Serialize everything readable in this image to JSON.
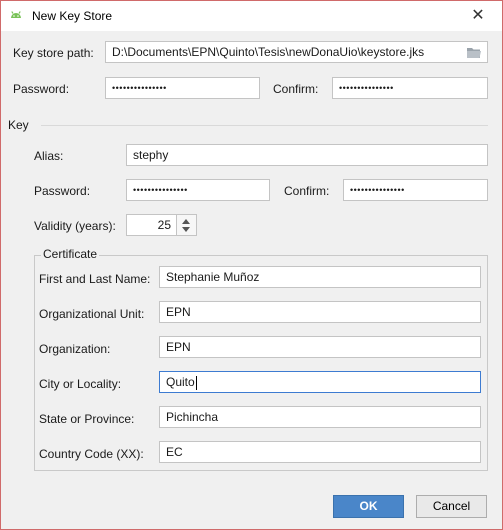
{
  "window": {
    "title": "New Key Store",
    "close_glyph": "✕",
    "icon": "android-icon"
  },
  "keystore": {
    "path_label": "Key store path:",
    "path_value": "D:\\Documents\\EPN\\Quinto\\Tesis\\newDonaUio\\keystore.jks",
    "browse_icon": "folder-icon",
    "password_label": "Password:",
    "password_value": "•••••••••••••••",
    "confirm_label": "Confirm:",
    "confirm_value": "•••••••••••••••"
  },
  "key": {
    "group_label": "Key",
    "alias_label": "Alias:",
    "alias_value": "stephy",
    "password_label": "Password:",
    "password_value": "•••••••••••••••",
    "confirm_label": "Confirm:",
    "confirm_value": "•••••••••••••••",
    "validity_label": "Validity (years):",
    "validity_value": "25"
  },
  "certificate": {
    "group_label": "Certificate",
    "fields": [
      {
        "label": "First and Last Name:",
        "value": "Stephanie Muñoz"
      },
      {
        "label": "Organizational Unit:",
        "value": "EPN"
      },
      {
        "label": "Organization:",
        "value": "EPN"
      },
      {
        "label": "City or Locality:",
        "value": "Quito"
      },
      {
        "label": "State or Province:",
        "value": "Pichincha"
      },
      {
        "label": "Country Code (XX):",
        "value": "EC"
      }
    ]
  },
  "buttons": {
    "ok_label": "OK",
    "cancel_label": "Cancel"
  },
  "colors": {
    "primary_button": "#4a86c9",
    "focus_border": "#3d7bd1",
    "android_green": "#78c257"
  }
}
